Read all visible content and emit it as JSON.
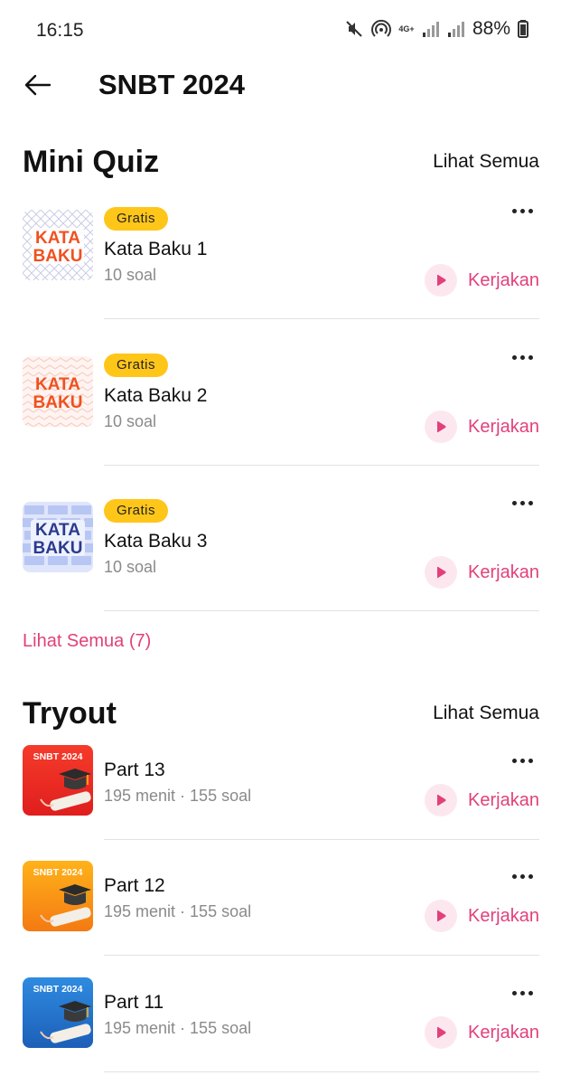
{
  "status": {
    "time": "16:15",
    "network": "4G+",
    "battery": "88%",
    "icons": [
      "mute-icon",
      "hotspot-icon",
      "signal-icon",
      "battery-icon"
    ]
  },
  "header": {
    "title": "SNBT 2024",
    "back_icon": "arrow-left-icon"
  },
  "mini_quiz": {
    "title": "Mini Quiz",
    "see_all": "Lihat Semua",
    "see_all_count": "Lihat Semua (7)",
    "items": [
      {
        "thumb_line1": "KATA",
        "thumb_line2": "BAKU",
        "badge": "Gratis",
        "title": "Kata Baku 1",
        "subtitle": "10 soal",
        "action": "Kerjakan"
      },
      {
        "thumb_line1": "KATA",
        "thumb_line2": "BAKU",
        "badge": "Gratis",
        "title": "Kata Baku 2",
        "subtitle": "10 soal",
        "action": "Kerjakan"
      },
      {
        "thumb_line1": "KATA",
        "thumb_line2": "BAKU",
        "badge": "Gratis",
        "title": "Kata Baku 3",
        "subtitle": "10 soal",
        "action": "Kerjakan"
      }
    ]
  },
  "tryout": {
    "title": "Tryout",
    "see_all": "Lihat Semua",
    "items": [
      {
        "thumb_label": "SNBT 2024",
        "title": "Part 13",
        "subtitle": "195 menit · 155 soal",
        "action": "Kerjakan"
      },
      {
        "thumb_label": "SNBT 2024",
        "title": "Part 12",
        "subtitle": "195 menit · 155 soal",
        "action": "Kerjakan"
      },
      {
        "thumb_label": "SNBT 2024",
        "title": "Part 11",
        "subtitle": "195 menit · 155 soal",
        "action": "Kerjakan"
      }
    ]
  },
  "colors": {
    "accent": "#E2407A",
    "badge": "#FFC61A",
    "play_bg": "#FDE7EE"
  }
}
